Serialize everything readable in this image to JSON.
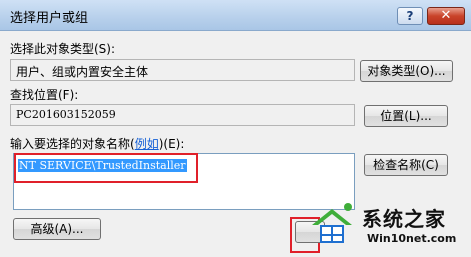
{
  "window": {
    "title": "选择用户或组",
    "help_label": "?",
    "close_label": "✕"
  },
  "object_type": {
    "label": "选择此对象类型(S):",
    "value": "用户、组或内置安全主体",
    "button": "对象类型(O)..."
  },
  "location": {
    "label": "查找位置(F):",
    "value": "PC201603152059",
    "button": "位置(L)..."
  },
  "names": {
    "label_prefix": "输入要选择的对象名称(",
    "label_link": "例如",
    "label_suffix": ")(E):",
    "value": "NT SERVICE\\TrustedInstaller",
    "check_button": "检查名称(C)"
  },
  "footer": {
    "advanced_button": "高级(A)..."
  },
  "watermark": {
    "name": "系统之家",
    "url": "Win10net.com",
    "colors": {
      "blue": "#1e6fd0",
      "green": "#3fae3a"
    }
  },
  "colors": {
    "highlight": "#e0202a",
    "selection": "#3399ff",
    "link": "#1560d6"
  }
}
